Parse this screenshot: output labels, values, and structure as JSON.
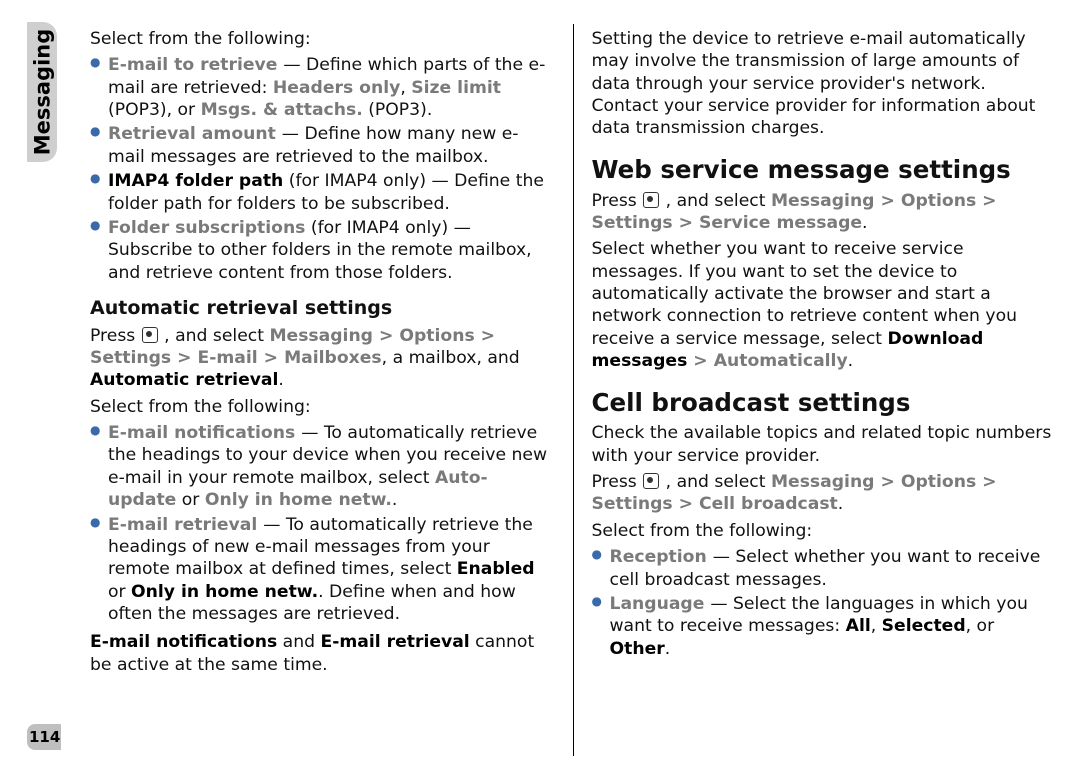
{
  "sideTab": "Messaging",
  "pageNumber": "114",
  "col1": {
    "intro": "Select from the following:",
    "list1": {
      "i0_term": "E-mail to retrieve ",
      "i0_a": " — Define which parts of the e-mail are retrieved: ",
      "i0_b": "Headers only",
      "i0_c": ", ",
      "i0_d": "Size limit",
      "i0_e": " (POP3), or ",
      "i0_f": "Msgs. & attachs.",
      "i0_g": " (POP3).",
      "i1_term": "Retrieval amount ",
      "i1_a": " — Define how many new e-mail messages are retrieved to the mailbox.",
      "i2_term": "IMAP4 folder path",
      "i2_a": " (for IMAP4 only)  — Define the folder path for folders to be subscribed.",
      "i3_term": "Folder subscriptions",
      "i3_a": " (for IMAP4 only)  — Subscribe to other folders in the remote mailbox, and retrieve content from those folders."
    },
    "h_auto": "Automatic retrieval settings",
    "auto_press_a": "Press ",
    "auto_press_b": " , and select ",
    "auto_path_a": "Messaging",
    "auto_path_b": "Options",
    "auto_path_c": "Settings",
    "auto_path_d": "E-mail",
    "auto_path_e": "Mailboxes",
    "auto_press_c": ", a mailbox, and ",
    "auto_path_f": "Automatic retrieval",
    "auto_press_d": ".",
    "select2": "Select from the following:",
    "list2": {
      "i0_term": "E-mail notifications ",
      "i0_a": " — To automatically retrieve the headings to your device when you receive new e-mail in your remote mailbox, select ",
      "i0_b": "Auto-update",
      "i0_c": " or ",
      "i0_d": "Only in home netw.",
      "i0_e": ".",
      "i1_term": "E-mail retrieval ",
      "i1_a": " — To automatically retrieve the headings of new e-mail messages from your remote mailbox at defined times, select ",
      "i1_b": "Enabled",
      "i1_c": " or ",
      "i1_d": "Only in home netw.",
      "i1_e": ". Define when and how often the messages are retrieved."
    },
    "note_a": "E-mail notifications",
    "note_b": " and ",
    "note_c": "E-mail retrieval",
    "note_d": " cannot be active at the same time."
  },
  "col2": {
    "top": "Setting the device to retrieve e-mail automatically may involve the transmission of large amounts of data through your service provider's network. Contact your service provider for information about data transmission charges.",
    "h_web": "Web service message settings",
    "web_press_a": "Press ",
    "web_press_b": " , and select ",
    "web_path_a": "Messaging",
    "web_path_b": "Options",
    "web_path_c": "Settings",
    "web_path_d": "Service message",
    "web_press_c": ".",
    "web_body_a": "Select whether you want to receive service messages. If you want to set the device to automatically activate the browser and start a network connection to retrieve content when you receive a service message, select ",
    "web_body_b": "Download messages",
    "web_body_c": "Automatically",
    "web_body_d": ".",
    "h_cell": "Cell broadcast settings",
    "cell_check": "Check the available topics and related topic numbers with your service provider.",
    "cell_press_a": "Press ",
    "cell_press_b": " , and select ",
    "cell_path_a": "Messaging",
    "cell_path_b": "Options",
    "cell_path_c": "Settings",
    "cell_path_d": "Cell broadcast",
    "cell_press_c": ".",
    "cell_select": "Select from the following:",
    "list": {
      "i0_term": "Reception ",
      "i0_a": " — Select whether you want to receive cell broadcast messages.",
      "i1_term": "Language ",
      "i1_a": " — Select the languages in which you want to receive messages: ",
      "i1_b": "All",
      "i1_c": ", ",
      "i1_d": "Selected",
      "i1_e": ", or ",
      "i1_f": "Other",
      "i1_g": "."
    }
  },
  "gt": " > "
}
